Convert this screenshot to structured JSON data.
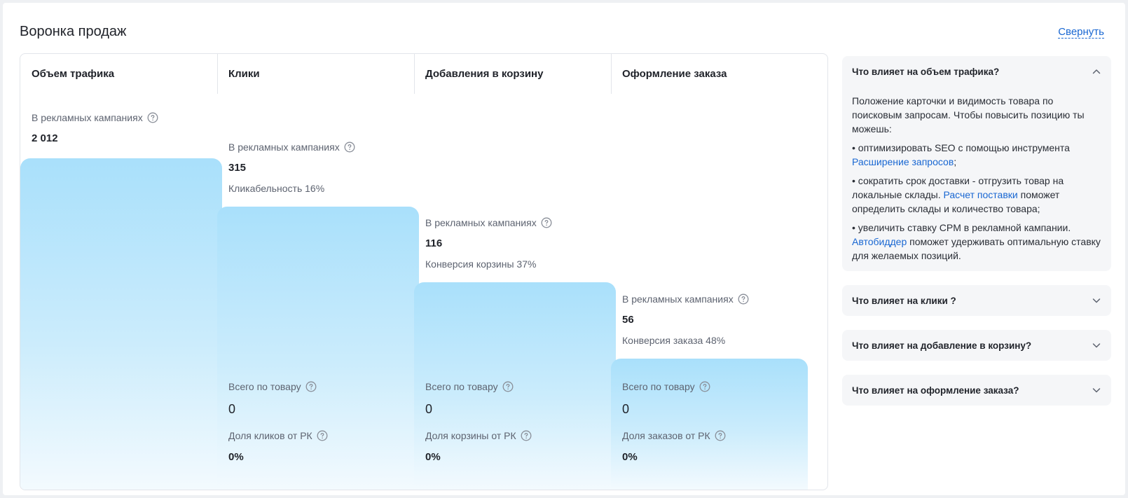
{
  "header": {
    "title": "Воронка продаж",
    "collapse_label": "Свернуть"
  },
  "funnel": {
    "columns": [
      {
        "title": "Объем трафика",
        "campaign_label": "В рекламных кампаниях",
        "campaign_value": "2 012"
      },
      {
        "title": "Клики",
        "campaign_label": "В рекламных кампаниях",
        "campaign_value": "315",
        "rate": "Кликабельность 16%",
        "total_label": "Всего по товару",
        "total_value": "0",
        "share_label": "Доля кликов от РК",
        "share_value": "0%"
      },
      {
        "title": "Добавления в корзину",
        "campaign_label": "В рекламных кампаниях",
        "campaign_value": "116",
        "rate": "Конверсия корзины 37%",
        "total_label": "Всего по товару",
        "total_value": "0",
        "share_label": "Доля корзины от РК",
        "share_value": "0%"
      },
      {
        "title": "Оформление заказа",
        "campaign_label": "В рекламных кампаниях",
        "campaign_value": "56",
        "rate": "Конверсия заказа 48%",
        "total_label": "Всего по товару",
        "total_value": "0",
        "share_label": "Доля заказов от РК",
        "share_value": "0%"
      }
    ]
  },
  "sidebar": {
    "traffic": {
      "title": "Что влияет на объем трафика?",
      "intro": "Положение карточки и видимость товара по поисковым запросам. Чтобы повысить позицию ты можешь:",
      "b1_text": "• оптимизировать SEO с помощью инструмента ",
      "b1_link": "Расширение запросов",
      "b1_end": ";",
      "b2_text": "• сократить срок доставки - отгрузить товар на локальные склады. ",
      "b2_link": "Расчет поставки",
      "b2_end": " поможет определить склады и количество товара;",
      "b3_text": "• увеличить ставку CPM в рекламной кампании. ",
      "b3_link": "Автобиддер",
      "b3_end": " поможет удерживать оптимальную ставку для желаемых позиций."
    },
    "clicks_title": "Что влияет на клики ?",
    "cart_title": "Что влияет на добавление в корзину?",
    "order_title": "Что влияет на оформление заказа?"
  }
}
